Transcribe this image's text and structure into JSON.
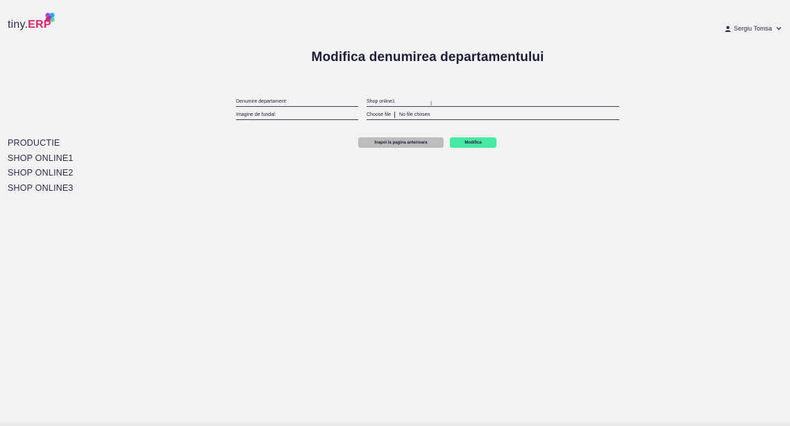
{
  "header": {
    "logo_prefix": "tiny.",
    "logo_suffix": "ERP",
    "user_name": "Sergiu Tomsa"
  },
  "page": {
    "title": "Modifica denumirea departamentului"
  },
  "form": {
    "name_label": "Denumire departament:",
    "name_value": "Shop online1",
    "image_label": "Imagine de fundal:",
    "file_button": "Choose file",
    "file_status": "No file chosen"
  },
  "buttons": {
    "back": "Inapoi la pagina anterioara",
    "modify": "Modifica"
  },
  "sidebar": {
    "items": [
      {
        "label": "PRODUCTIE"
      },
      {
        "label": "SHOP ONLINE1"
      },
      {
        "label": "SHOP ONLINE2"
      },
      {
        "label": "SHOP ONLINE3"
      }
    ]
  },
  "colors": {
    "background": "#f2f2f2",
    "logo_accent": "#e2246e",
    "primary_button": "#45e8a4",
    "secondary_button": "#bdbdbd",
    "text": "#1d1f3a"
  }
}
